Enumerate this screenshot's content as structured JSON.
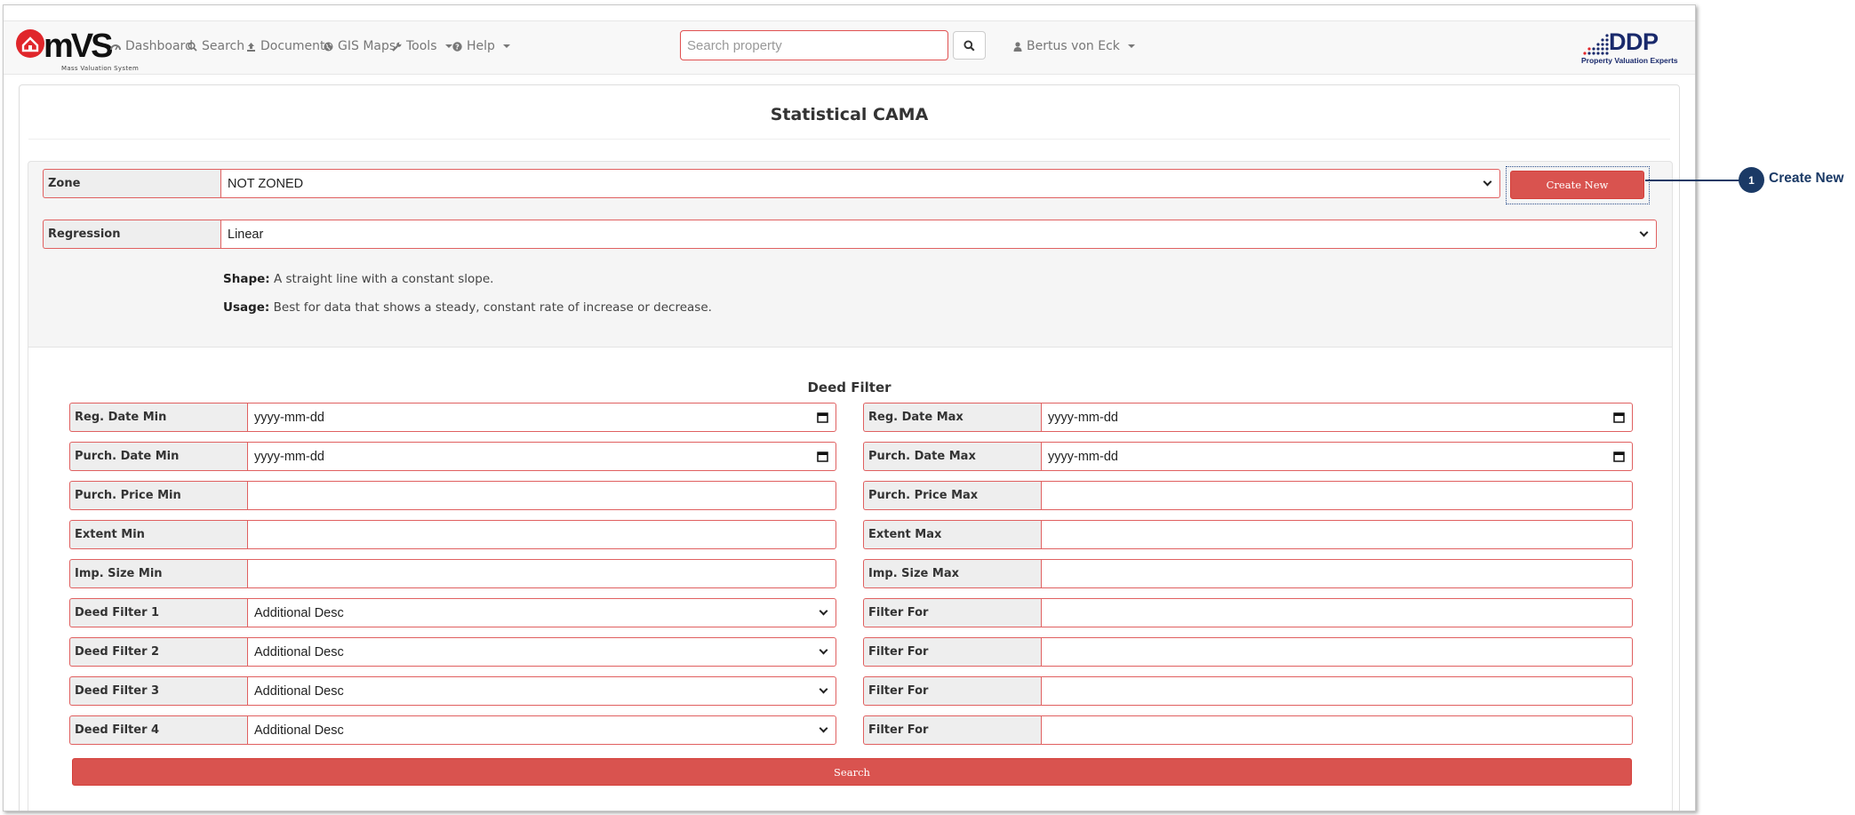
{
  "brand": {
    "logo_text": "mVS",
    "logo_subtitle": "Mass Valuation System",
    "partner_logo_text": "DDP",
    "partner_logo_subtitle": "Property Valuation Experts"
  },
  "nav": {
    "items": [
      {
        "label": "Dashboard",
        "icon": "dashboard-icon"
      },
      {
        "label": "Search",
        "icon": "search-icon"
      },
      {
        "label": "Documents",
        "icon": "upload-icon"
      },
      {
        "label": "GIS Maps",
        "icon": "globe-icon"
      },
      {
        "label": "Tools",
        "icon": "wrench-icon",
        "dropdown": true
      },
      {
        "label": "Help",
        "icon": "question-circle-icon",
        "dropdown": true
      }
    ],
    "search_placeholder": "Search property",
    "user": {
      "label": "Bertus von Eck",
      "icon": "user-icon"
    }
  },
  "page": {
    "title": "Statistical CAMA"
  },
  "zone": {
    "label": "Zone",
    "value": "NOT ZONED"
  },
  "create_new_label": "Create New",
  "regression": {
    "label": "Regression",
    "value": "Linear",
    "shape_label": "Shape:",
    "shape_text": "A straight line with a constant slope.",
    "usage_label": "Usage:",
    "usage_text": "Best for data that shows a steady, constant rate of increase or decrease."
  },
  "deed_filter": {
    "title": "Deed Filter",
    "left": [
      {
        "label": "Reg. Date Min",
        "value": "yyyy-mm-dd",
        "kind": "date"
      },
      {
        "label": "Purch. Date Min",
        "value": "yyyy-mm-dd",
        "kind": "date"
      },
      {
        "label": "Purch. Price Min",
        "value": "",
        "kind": "text"
      },
      {
        "label": "Extent Min",
        "value": "",
        "kind": "text"
      },
      {
        "label": "Imp. Size Min",
        "value": "",
        "kind": "text"
      },
      {
        "label": "Deed Filter 1",
        "value": "Additional Desc",
        "kind": "select"
      },
      {
        "label": "Deed Filter 2",
        "value": "Additional Desc",
        "kind": "select"
      },
      {
        "label": "Deed Filter 3",
        "value": "Additional Desc",
        "kind": "select"
      },
      {
        "label": "Deed Filter 4",
        "value": "Additional Desc",
        "kind": "select"
      }
    ],
    "right": [
      {
        "label": "Reg. Date Max",
        "value": "yyyy-mm-dd",
        "kind": "date"
      },
      {
        "label": "Purch. Date Max",
        "value": "yyyy-mm-dd",
        "kind": "date"
      },
      {
        "label": "Purch. Price Max",
        "value": "",
        "kind": "text"
      },
      {
        "label": "Extent Max",
        "value": "",
        "kind": "text"
      },
      {
        "label": "Imp. Size Max",
        "value": "",
        "kind": "text"
      },
      {
        "label": "Filter For",
        "value": "",
        "kind": "text"
      },
      {
        "label": "Filter For",
        "value": "",
        "kind": "text"
      },
      {
        "label": "Filter For",
        "value": "",
        "kind": "text"
      },
      {
        "label": "Filter For",
        "value": "",
        "kind": "text"
      }
    ],
    "search_label": "Search"
  },
  "callout": {
    "number": "1",
    "label": "Create New"
  },
  "colors": {
    "accent_red": "#d9534f",
    "field_border": "#e06060",
    "callout_navy": "#1b3a66",
    "logo_red": "#e0262b",
    "partner_navy": "#1a2a6c"
  }
}
